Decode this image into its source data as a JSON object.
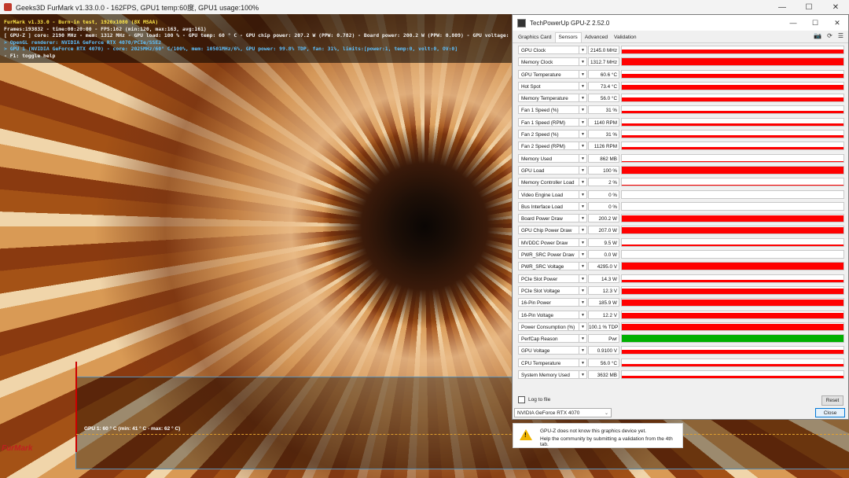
{
  "furmark": {
    "title": "Geeks3D FurMark v1.33.0.0 - 162FPS, GPU1 temp:60度, GPU1 usage:100%",
    "osd": [
      {
        "text": "FurMark v1.33.0 - Burn-in test, 1920x1080 (8X MSAA)",
        "color": "yellow"
      },
      {
        "text": "Frames:193832 - time:00:20:00 - FPS:162 (min:120, max:163, avg:161)",
        "color": "white"
      },
      {
        "text": "[ GPU-Z ] core: 2190 MHz - mem: 1312 MHz - GPU load: 100 % - GPU temp: 60 ° C - GPU chip power: 207.2 W (PPW: 0.782) - Board power: 200.2 W (PPW: 0.809) - GPU voltage: 0.910 V",
        "color": "white"
      },
      {
        "text": "> OpenGL renderer: NVIDIA GeForce RTX 4070/PCIe/SSE2",
        "color": "blue"
      },
      {
        "text": "> GPU 1 (NVIDIA GeForce RTX 4070) - core: 2025MHz/60° C/100%, mem: 10501MHz/6%, GPU power: 99.8% TDP, fan: 31%, limits:[power:1, temp:0, volt:0, OV:0]",
        "color": "blue"
      },
      {
        "text": "- F1: toggle help",
        "color": "white"
      }
    ],
    "graph_label": "GPU 1: 60 ° C (min: 41 ° C - max: 62 ° C)",
    "logo": "FurMark"
  },
  "window_controls": {
    "minimize": "—",
    "maximize": "☐",
    "close": "✕"
  },
  "gpuz": {
    "title": "TechPowerUp GPU-Z 2.52.0",
    "tabs": [
      "Graphics Card",
      "Sensors",
      "Advanced",
      "Validation"
    ],
    "active_tab": "Sensors",
    "tool_icons": {
      "camera": "📷",
      "refresh": "⟳",
      "menu": "☰"
    },
    "sensors": [
      {
        "name": "GPU Clock",
        "value": "2145.0 MHz",
        "level": 0.6,
        "color": "#ff0000"
      },
      {
        "name": "Memory Clock",
        "value": "1312.7 MHz",
        "level": 1.0,
        "color": "#ff0000"
      },
      {
        "name": "GPU Temperature",
        "value": "60.6 °C",
        "level": 0.5,
        "color": "#ff0000"
      },
      {
        "name": "Hot Spot",
        "value": "73.4 °C",
        "level": 0.7,
        "color": "#ff0000"
      },
      {
        "name": "Memory Temperature",
        "value": "56.0 °C",
        "level": 0.5,
        "color": "#ff0000"
      },
      {
        "name": "Fan 1 Speed (%)",
        "value": "31 %",
        "level": 0.3,
        "color": "#ff0000"
      },
      {
        "name": "Fan 1 Speed (RPM)",
        "value": "1140 RPM",
        "level": 0.3,
        "color": "#ff0000"
      },
      {
        "name": "Fan 2 Speed (%)",
        "value": "31 %",
        "level": 0.3,
        "color": "#ff0000"
      },
      {
        "name": "Fan 2 Speed (RPM)",
        "value": "1126 RPM",
        "level": 0.3,
        "color": "#ff0000"
      },
      {
        "name": "Memory Used",
        "value": "862 MB",
        "level": 0.15,
        "color": "#ff0000"
      },
      {
        "name": "GPU Load",
        "value": "100 %",
        "level": 1.0,
        "color": "#ff0000"
      },
      {
        "name": "Memory Controller Load",
        "value": "2 %",
        "level": 0.05,
        "color": "#ff0000"
      },
      {
        "name": "Video Engine Load",
        "value": "0 %",
        "level": 0.0,
        "color": "#ff0000"
      },
      {
        "name": "Bus Interface Load",
        "value": "0 %",
        "level": 0.0,
        "color": "#ff0000"
      },
      {
        "name": "Board Power Draw",
        "value": "200.2 W",
        "level": 0.85,
        "color": "#ff0000"
      },
      {
        "name": "GPU Chip Power Draw",
        "value": "207.0 W",
        "level": 0.85,
        "color": "#ff0000"
      },
      {
        "name": "MVDDC Power Draw",
        "value": "9.5 W",
        "level": 0.25,
        "color": "#ff0000"
      },
      {
        "name": "PWR_SRC Power Draw",
        "value": "0.0 W",
        "level": 0.0,
        "color": "#ff0000"
      },
      {
        "name": "PWR_SRC Voltage",
        "value": "4295.0 V",
        "level": 1.0,
        "color": "#ff0000"
      },
      {
        "name": "PCIe Slot Power",
        "value": "14.3 W",
        "level": 0.3,
        "color": "#ff0000"
      },
      {
        "name": "PCIe Slot Voltage",
        "value": "12.3 V",
        "level": 0.8,
        "color": "#ff0000"
      },
      {
        "name": "16-Pin Power",
        "value": "185.9 W",
        "level": 0.85,
        "color": "#ff0000"
      },
      {
        "name": "16-Pin Voltage",
        "value": "12.2 V",
        "level": 0.8,
        "color": "#ff0000"
      },
      {
        "name": "Power Consumption (%)",
        "value": "100.1 % TDP",
        "level": 0.9,
        "color": "#ff0000"
      },
      {
        "name": "PerfCap Reason",
        "value": "Pwr",
        "level": 1.0,
        "color": "#00b000"
      },
      {
        "name": "GPU Voltage",
        "value": "0.9100 V",
        "level": 0.5,
        "color": "#ff0000"
      },
      {
        "name": "CPU Temperature",
        "value": "56.0 °C",
        "level": 0.35,
        "color": "#ff0000"
      },
      {
        "name": "System Memory Used",
        "value": "3632 MB",
        "level": 0.3,
        "color": "#ff0000"
      }
    ],
    "log_to_file": "Log to file",
    "reset": "Reset",
    "device": "NVIDIA GeForce RTX 4070",
    "close": "Close",
    "notice_line1": "GPU-Z does not know this graphics device yet.",
    "notice_line2": "Help the community by submitting a validation from the 4th tab."
  }
}
